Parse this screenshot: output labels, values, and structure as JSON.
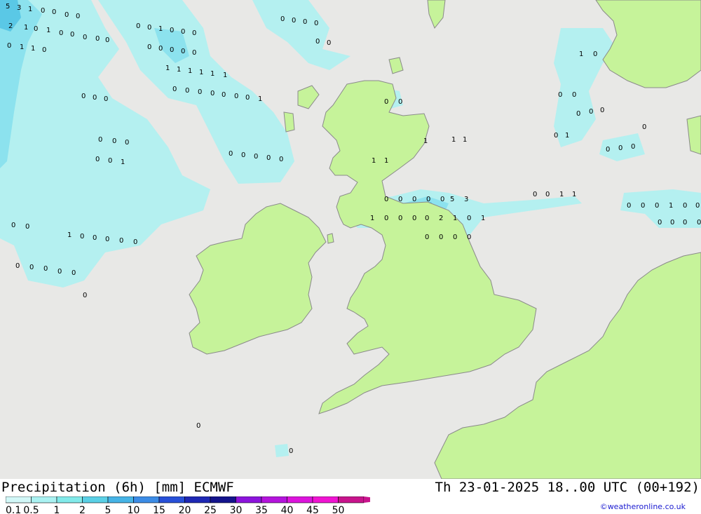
{
  "title_left": "Precipitation (6h) [mm] ECMWF",
  "title_right": "Th 23-01-2025 18..00 UTC (00+192)",
  "credit": "©weatheronline.co.uk",
  "legend": {
    "levels": [
      "0.1",
      "0.5",
      "1",
      "2",
      "5",
      "10",
      "15",
      "20",
      "25",
      "30",
      "35",
      "40",
      "45",
      "50"
    ],
    "colors": [
      "#d2f8f8",
      "#aaf2f2",
      "#82eaea",
      "#5ad0e6",
      "#46b4e6",
      "#3c8ce6",
      "#2850d8",
      "#1e28b4",
      "#14148c",
      "#8c14dc",
      "#b414dc",
      "#dc14dc",
      "#f014d2",
      "#c8148c"
    ]
  },
  "colors": {
    "sea": "#e8e8e6",
    "land": "#c6f39a",
    "border": "#8a8a8a",
    "precip_light": "#b4f0f0",
    "precip_mid": "#8ce2ee",
    "precip_heavy": "#5ac8e6"
  },
  "map_values": [
    "5",
    "3",
    "1",
    "0",
    "0",
    "0",
    "0",
    "2",
    "1",
    "0",
    "1",
    "0",
    "0",
    "0",
    "0",
    "0",
    "0",
    "1",
    "1",
    "0",
    "0",
    "0",
    "1",
    "0",
    "0",
    "0",
    "0",
    "0",
    "0",
    "0",
    "0",
    "1",
    "1",
    "1",
    "1",
    "1",
    "1",
    "0",
    "0",
    "0",
    "0",
    "0",
    "0",
    "0",
    "1",
    "0",
    "0",
    "0",
    "0",
    "0",
    "0",
    "0",
    "0",
    "0",
    "0",
    "0",
    "0",
    "0",
    "0",
    "1",
    "0",
    "0",
    "0",
    "0",
    "0",
    "0",
    "0",
    "0",
    "0",
    "0"
  ]
}
